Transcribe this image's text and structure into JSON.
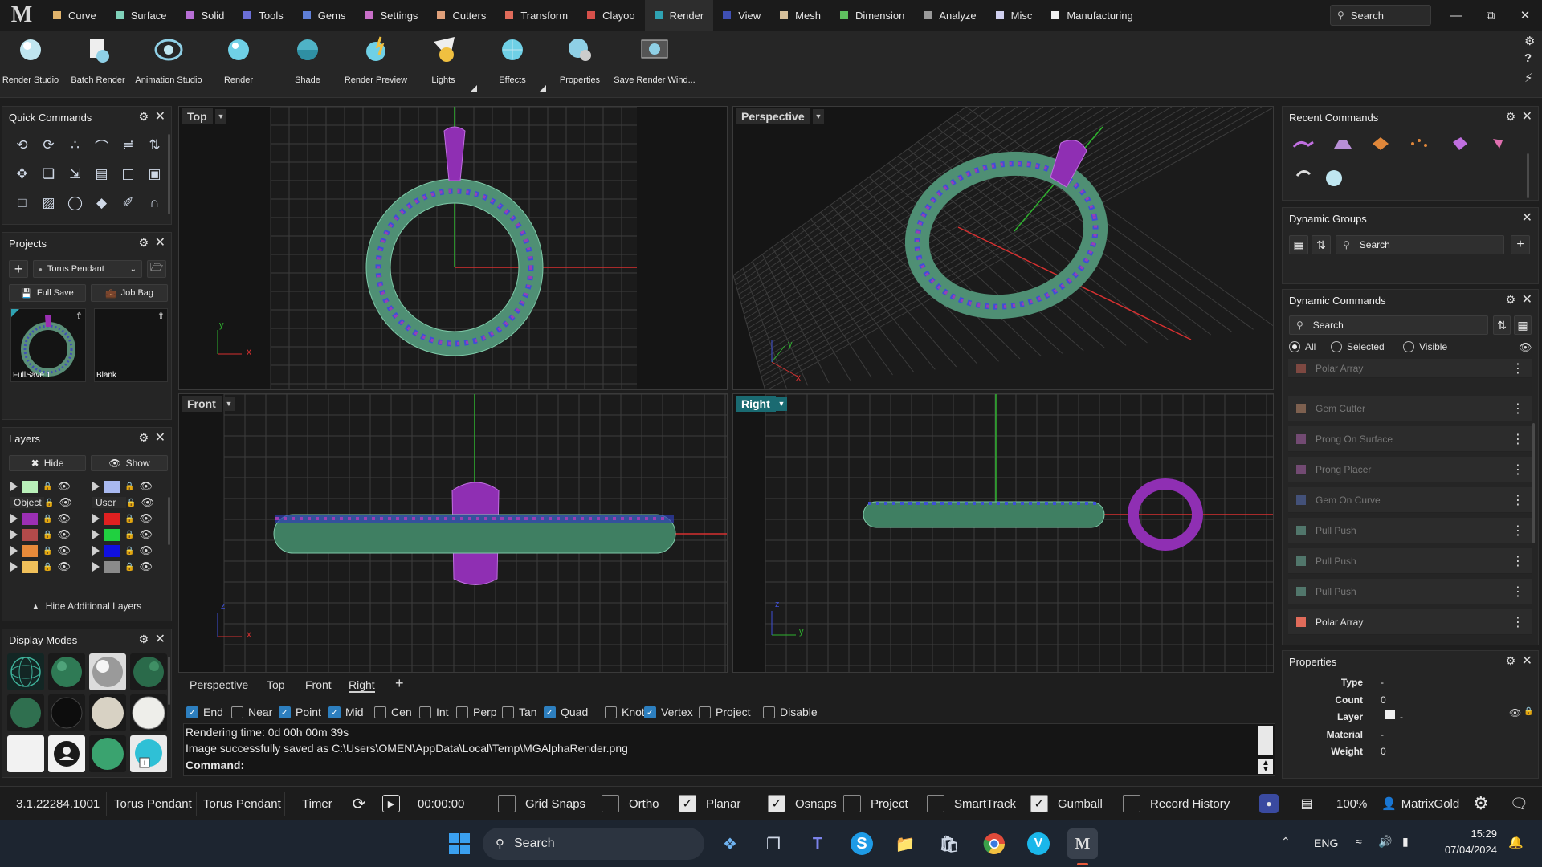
{
  "app": {
    "logo": "M"
  },
  "menu": {
    "tabs": [
      {
        "label": "Curve",
        "color": "#e0b36b"
      },
      {
        "label": "Surface",
        "color": "#7fd1b9"
      },
      {
        "label": "Solid",
        "color": "#b86fd6"
      },
      {
        "label": "Tools",
        "color": "#6b6fd6"
      },
      {
        "label": "Gems",
        "color": "#5f7fd6"
      },
      {
        "label": "Settings",
        "color": "#c86fc8"
      },
      {
        "label": "Cutters",
        "color": "#e0a07a"
      },
      {
        "label": "Transform",
        "color": "#e06b5a"
      },
      {
        "label": "Clayoo",
        "color": "#d6504a"
      },
      {
        "label": "Render",
        "color": "#2fa3b3"
      },
      {
        "label": "View",
        "color": "#3f4fb3"
      },
      {
        "label": "Mesh",
        "color": "#d6c09a"
      },
      {
        "label": "Dimension",
        "color": "#5fc05f"
      },
      {
        "label": "Analyze",
        "color": "#9a9a9a"
      },
      {
        "label": "Misc",
        "color": "#d0d0f0"
      },
      {
        "label": "Manufacturing",
        "color": "#f0f0f0"
      }
    ],
    "active": "Render",
    "search_label": "Search"
  },
  "ribbon": {
    "buttons": [
      {
        "label": "Render Studio",
        "icon": "render-studio-icon"
      },
      {
        "label": "Batch Render",
        "icon": "batch-render-icon"
      },
      {
        "label": "Animation Studio",
        "icon": "animation-studio-icon"
      },
      {
        "label": "Render",
        "icon": "render-icon"
      },
      {
        "label": "Shade",
        "icon": "shade-icon"
      },
      {
        "label": "Render Preview",
        "icon": "render-preview-icon"
      },
      {
        "label": "Lights",
        "icon": "lights-icon"
      },
      {
        "label": "Effects",
        "icon": "effects-icon"
      },
      {
        "label": "Properties",
        "icon": "properties-icon"
      },
      {
        "label": "Save Render Wind...",
        "icon": "save-render-window-icon"
      }
    ]
  },
  "quick_commands": {
    "title": "Quick Commands"
  },
  "projects": {
    "title": "Projects",
    "current": "Torus Pendant",
    "full_save": "Full Save",
    "job_bag": "Job Bag",
    "items": [
      {
        "label": "FullSave 1"
      },
      {
        "label": "Blank"
      }
    ]
  },
  "layers": {
    "title": "Layers",
    "hide": "Hide",
    "show": "Show",
    "left_col": [
      {
        "name": "",
        "color": "#b9f0b9"
      },
      {
        "name": "Object",
        "color": ""
      },
      {
        "name": "",
        "color": "#9b2fb3"
      },
      {
        "name": "",
        "color": "#b34a4a"
      },
      {
        "name": "",
        "color": "#e88a3a"
      },
      {
        "name": "",
        "color": "#f0c05a"
      }
    ],
    "right_col": [
      {
        "name": "",
        "color": "#a9b9f0"
      },
      {
        "name": "User",
        "color": ""
      },
      {
        "name": "",
        "color": "#e02020"
      },
      {
        "name": "",
        "color": "#20d040"
      },
      {
        "name": "",
        "color": "#1010e0"
      },
      {
        "name": "",
        "color": "#8a8a8a"
      }
    ],
    "hide_additional": "Hide Additional Layers"
  },
  "display_modes": {
    "title": "Display Modes"
  },
  "viewports": {
    "top": "Top",
    "perspective": "Perspective",
    "front": "Front",
    "right": "Right",
    "axis_x": "x",
    "axis_y": "y",
    "axis_z": "z"
  },
  "viewport_tabs": [
    "Perspective",
    "Top",
    "Front",
    "Right"
  ],
  "viewport_tabs_active": "Right",
  "osnaps": [
    {
      "label": "End",
      "checked": true
    },
    {
      "label": "Near",
      "checked": false
    },
    {
      "label": "Point",
      "checked": true
    },
    {
      "label": "Mid",
      "checked": true
    },
    {
      "label": "Cen",
      "checked": false
    },
    {
      "label": "Int",
      "checked": false
    },
    {
      "label": "Perp",
      "checked": false
    },
    {
      "label": "Tan",
      "checked": false
    },
    {
      "label": "Quad",
      "checked": true
    },
    {
      "label": "Knot",
      "checked": false
    },
    {
      "label": "Vertex",
      "checked": true
    },
    {
      "label": "Project",
      "checked": false
    },
    {
      "label": "Disable",
      "checked": false
    }
  ],
  "command": {
    "line1": "Rendering time: 0d 00h 00m 39s",
    "line2": "Image successfully saved as C:\\Users\\OMEN\\AppData\\Local\\Temp\\MGAlphaRender.png",
    "prompt": "Command:"
  },
  "recent_commands": {
    "title": "Recent Commands"
  },
  "dynamic_groups": {
    "title": "Dynamic Groups",
    "search_placeholder": "Search"
  },
  "dynamic_commands": {
    "title": "Dynamic Commands",
    "search_placeholder": "Search",
    "filters": [
      {
        "label": "All",
        "selected": true
      },
      {
        "label": "Selected",
        "selected": false
      },
      {
        "label": "Visible",
        "selected": false
      }
    ],
    "items": [
      {
        "label": "Polar Array",
        "color": "#e06b5a",
        "dim": true
      },
      {
        "label": "Gem Cutter",
        "color": "#e0a07a",
        "dim": true
      },
      {
        "label": "Prong On Surface",
        "color": "#c86fc8",
        "dim": true
      },
      {
        "label": "Prong Placer",
        "color": "#c86fc8",
        "dim": true
      },
      {
        "label": "Gem On Curve",
        "color": "#5f7fd6",
        "dim": true
      },
      {
        "label": "Pull Push",
        "color": "#7fd1b9",
        "dim": true
      },
      {
        "label": "Pull Push",
        "color": "#7fd1b9",
        "dim": true
      },
      {
        "label": "Pull Push",
        "color": "#7fd1b9",
        "dim": true
      },
      {
        "label": "Polar Array",
        "color": "#e06b5a",
        "dim": false
      }
    ]
  },
  "properties": {
    "title": "Properties",
    "rows": [
      {
        "key": "Type",
        "value": "-"
      },
      {
        "key": "Count",
        "value": "0"
      },
      {
        "key": "Layer",
        "value": "-"
      },
      {
        "key": "Material",
        "value": "-"
      },
      {
        "key": "Weight",
        "value": "0"
      }
    ]
  },
  "statusbar": {
    "version": "3.1.22284.1001",
    "project1": "Torus Pendant",
    "project2": "Torus Pendant",
    "timer_label": "Timer",
    "timer_value": "00:00:00",
    "toggles": [
      {
        "label": "Grid Snaps",
        "checked": false
      },
      {
        "label": "Ortho",
        "checked": false
      },
      {
        "label": "Planar",
        "checked": true
      },
      {
        "label": "Osnaps",
        "checked": true
      },
      {
        "label": "Project",
        "checked": false
      },
      {
        "label": "SmartTrack",
        "checked": false
      },
      {
        "label": "Gumball",
        "checked": true
      },
      {
        "label": "Record History",
        "checked": false
      }
    ],
    "zoom": "100%",
    "user": "MatrixGold"
  },
  "taskbar": {
    "search_label": "Search",
    "lang": "ENG",
    "time": "15:29",
    "date": "07/04/2024"
  }
}
